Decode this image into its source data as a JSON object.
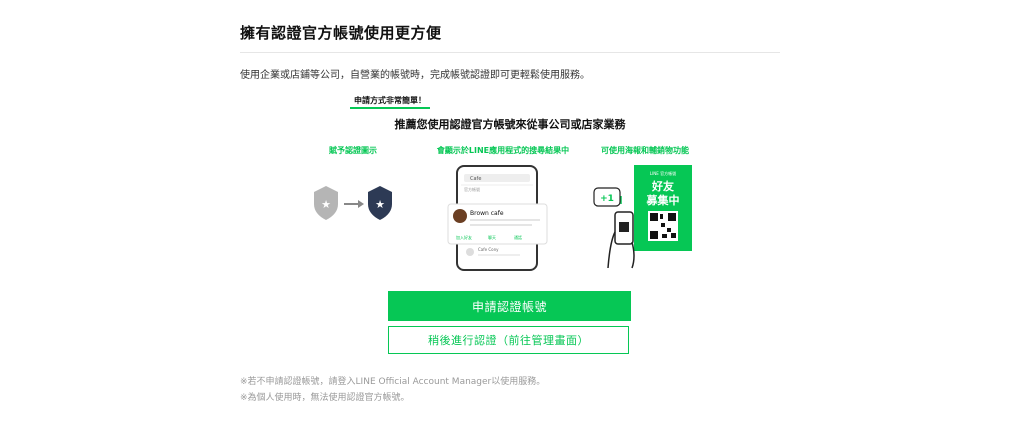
{
  "header": {
    "title": "擁有認證官方帳號使用更方便"
  },
  "description": "使用企業或店鋪等公司，自營業的帳號時，完成帳號認證即可更輕鬆使用服務。",
  "illustration": {
    "pill_label": "申請方式非常簡單！",
    "headline": "推薦您使用認證官方帳號來從事公司或店家業務",
    "features": [
      "賦予認證圖示",
      "會顯示於LINE應用程式的搜尋結果中",
      "可使用海報和輔銷物功能"
    ],
    "phone": {
      "search_text": "Cafe",
      "section_label": "官方帳號",
      "card_name": "Brown cafe",
      "card_actions": [
        "加入好友",
        "聊天",
        "通話"
      ],
      "second_name": "Cafe Cony"
    },
    "plus_badge": "+1",
    "poster": {
      "small_text": "LINE 官方帳號",
      "line1": "好友",
      "line2": "募集中"
    },
    "colors": {
      "accent": "#06c755",
      "badge_gray": "#b5b5b5",
      "badge_navy": "#2d3a55"
    }
  },
  "actions": {
    "primary_label": "申請認證帳號",
    "secondary_label": "稍後進行認證（前往管理畫面）"
  },
  "notes": [
    "※若不申請認證帳號，請登入LINE Official Account Manager以使用服務。",
    "※為個人使用時，無法使用認證官方帳號。"
  ]
}
